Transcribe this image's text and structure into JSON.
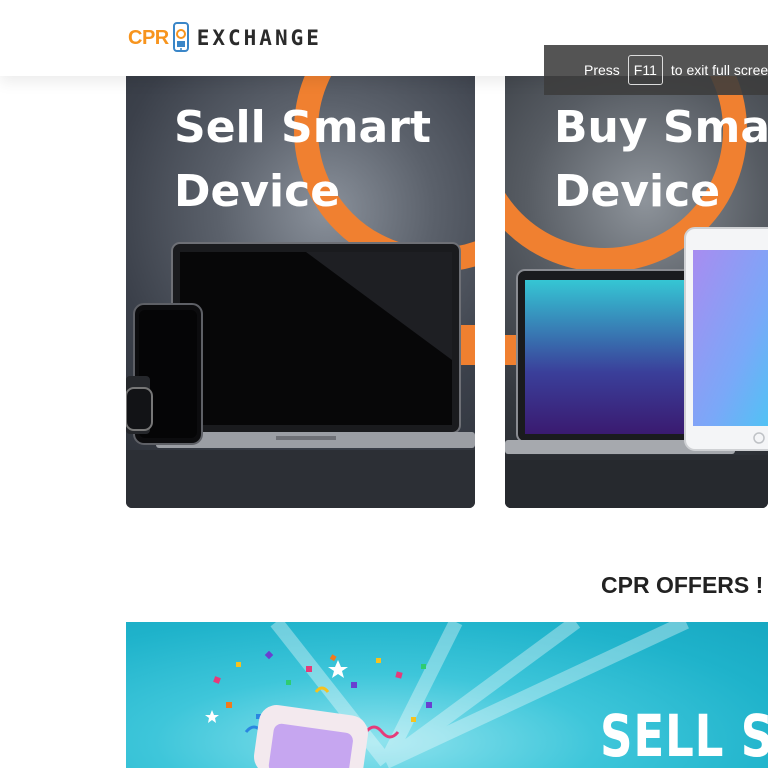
{
  "header": {
    "logo": {
      "left_text": "CPR",
      "right_text": "EXCHANGE",
      "icon": "phone-recycle-icon"
    }
  },
  "fullscreen_notice": {
    "prefix": "Press",
    "key": "F11",
    "suffix": "to exit full scree"
  },
  "cards": [
    {
      "title_line1": "Sell Smart",
      "title_line2": "Device"
    },
    {
      "title_line1": "Buy Smart",
      "title_line2": "Device"
    }
  ],
  "offers": {
    "heading": "CPR OFFERS !",
    "banner_text": "SELL SM"
  },
  "colors": {
    "brand_orange": "#f7941d",
    "banner_cyan": "#1fb3cb",
    "card_dark": "#3b404a"
  }
}
